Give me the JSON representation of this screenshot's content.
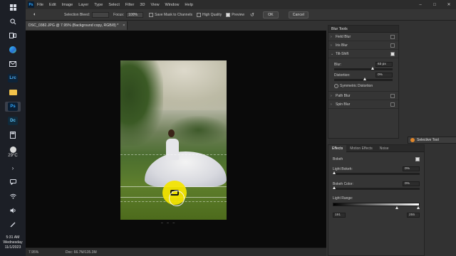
{
  "taskbar": {
    "weather_temp": "29°C",
    "clock_time": "5:31 AM",
    "clock_day": "Wednesday",
    "clock_date": "11/1/2023",
    "apps": [
      "Lrc",
      "Ps",
      "Dc"
    ]
  },
  "menubar": {
    "items": [
      "File",
      "Edit",
      "Image",
      "Layer",
      "Type",
      "Select",
      "Filter",
      "3D",
      "View",
      "Window",
      "Help"
    ]
  },
  "options": {
    "selection_bleed_label": "Selection Bleed:",
    "focus_label": "Focus:",
    "focus_value": "100%",
    "save_mask_label": "Save Mask to Channels",
    "high_quality_label": "High Quality",
    "preview_label": "Preview",
    "preview_checked": true,
    "ok_label": "OK",
    "cancel_label": "Cancel"
  },
  "document": {
    "tab_title": "DSC_0382.JPG @ 7.95% (Background copy, RGB/8) *",
    "zoom": "7.95%",
    "doc_size": "Doc: 66.7M/135.3M"
  },
  "blur_tools": {
    "title": "Blur Tools",
    "items": [
      {
        "label": "Field Blur",
        "checked": false,
        "expanded": false
      },
      {
        "label": "Iris Blur",
        "checked": false,
        "expanded": false
      },
      {
        "label": "Tilt-Shift",
        "checked": true,
        "expanded": true
      },
      {
        "label": "Path Blur",
        "checked": false,
        "expanded": false
      },
      {
        "label": "Spin Blur",
        "checked": false,
        "expanded": false
      }
    ],
    "tilt_shift": {
      "blur_label": "Blur:",
      "blur_value": "63 px",
      "blur_fraction": 0.63,
      "distortion_label": "Distortion:",
      "distortion_value": "0%",
      "distortion_fraction": 0.5,
      "symmetric_label": "Symmetric Distortion"
    }
  },
  "effects_panel": {
    "tabs": [
      "Effects",
      "Motion Effects",
      "Noise"
    ],
    "active_tab": "Effects",
    "bokeh_label": "Bokeh",
    "bokeh_checked": true,
    "light_bokeh_label": "Light Bokeh:",
    "light_bokeh_value": "0%",
    "bokeh_color_label": "Bokeh Color:",
    "bokeh_color_value": "0%",
    "light_range_label": "Light Range:",
    "light_range_low": "191",
    "light_range_high": "255"
  },
  "selective_tool": {
    "title": "Selective Tool"
  }
}
